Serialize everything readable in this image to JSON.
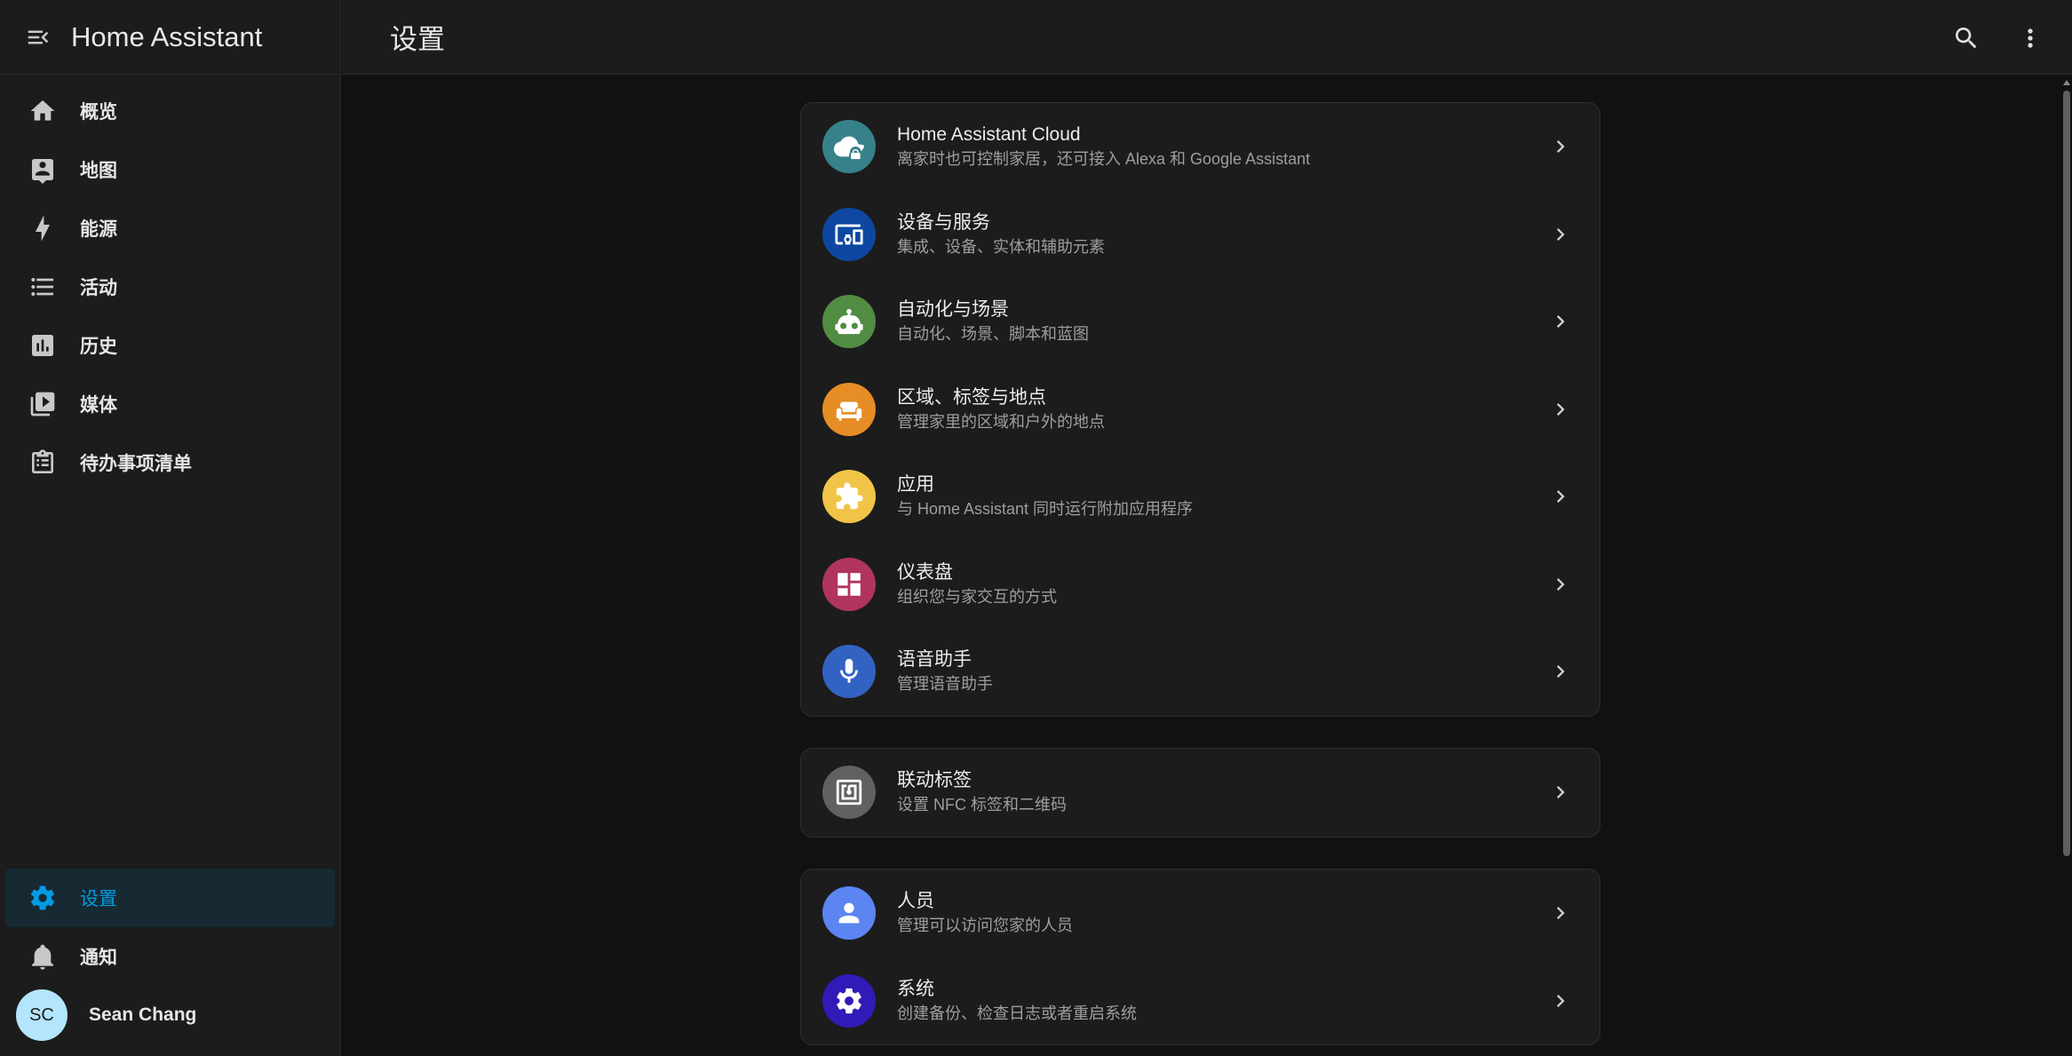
{
  "app": {
    "title": "Home Assistant"
  },
  "sidebar": {
    "items": [
      {
        "label": "概览",
        "icon": "home-icon"
      },
      {
        "label": "地图",
        "icon": "map-account-icon"
      },
      {
        "label": "能源",
        "icon": "lightning-bolt-icon"
      },
      {
        "label": "活动",
        "icon": "format-list-bulleted-icon"
      },
      {
        "label": "历史",
        "icon": "chart-box-icon"
      },
      {
        "label": "媒体",
        "icon": "play-box-multiple-icon"
      },
      {
        "label": "待办事项清单",
        "icon": "clipboard-list-icon"
      }
    ],
    "settings": {
      "label": "设置",
      "icon": "cog-icon"
    },
    "notifications": {
      "label": "通知",
      "icon": "bell-icon"
    },
    "user": {
      "initials": "SC",
      "name": "Sean Chang"
    }
  },
  "topbar": {
    "title": "设置"
  },
  "groups": [
    {
      "rows": [
        {
          "title": "Home Assistant Cloud",
          "subtitle": "离家时也可控制家居，还可接入 Alexa 和 Google Assistant",
          "icon": "cloud-lock-icon",
          "color": "#37818a"
        },
        {
          "title": "设备与服务",
          "subtitle": "集成、设备、实体和辅助元素",
          "icon": "devices-icon",
          "color": "#0d47a1"
        },
        {
          "title": "自动化与场景",
          "subtitle": "自动化、场景、脚本和蓝图",
          "icon": "robot-icon",
          "color": "#518c43"
        },
        {
          "title": "区域、标签与地点",
          "subtitle": "管理家里的区域和户外的地点",
          "icon": "sofa-icon",
          "color": "#e68d25"
        },
        {
          "title": "应用",
          "subtitle": "与 Home Assistant 同时运行附加应用程序",
          "icon": "puzzle-icon",
          "color": "#f1c447"
        },
        {
          "title": "仪表盘",
          "subtitle": "组织您与家交互的方式",
          "icon": "view-dashboard-icon",
          "color": "#b1345c"
        },
        {
          "title": "语音助手",
          "subtitle": "管理语音助手",
          "icon": "microphone-icon",
          "color": "#3263c3"
        }
      ]
    },
    {
      "rows": [
        {
          "title": "联动标签",
          "subtitle": "设置 NFC 标签和二维码",
          "icon": "nfc-tag-icon",
          "color": "#616161"
        }
      ]
    },
    {
      "rows": [
        {
          "title": "人员",
          "subtitle": "管理可以访问您家的人员",
          "icon": "account-icon",
          "color": "#5c85f2"
        },
        {
          "title": "系统",
          "subtitle": "创建备份、检查日志或者重启系统",
          "icon": "cog-icon",
          "color": "#301ab8"
        }
      ]
    }
  ]
}
